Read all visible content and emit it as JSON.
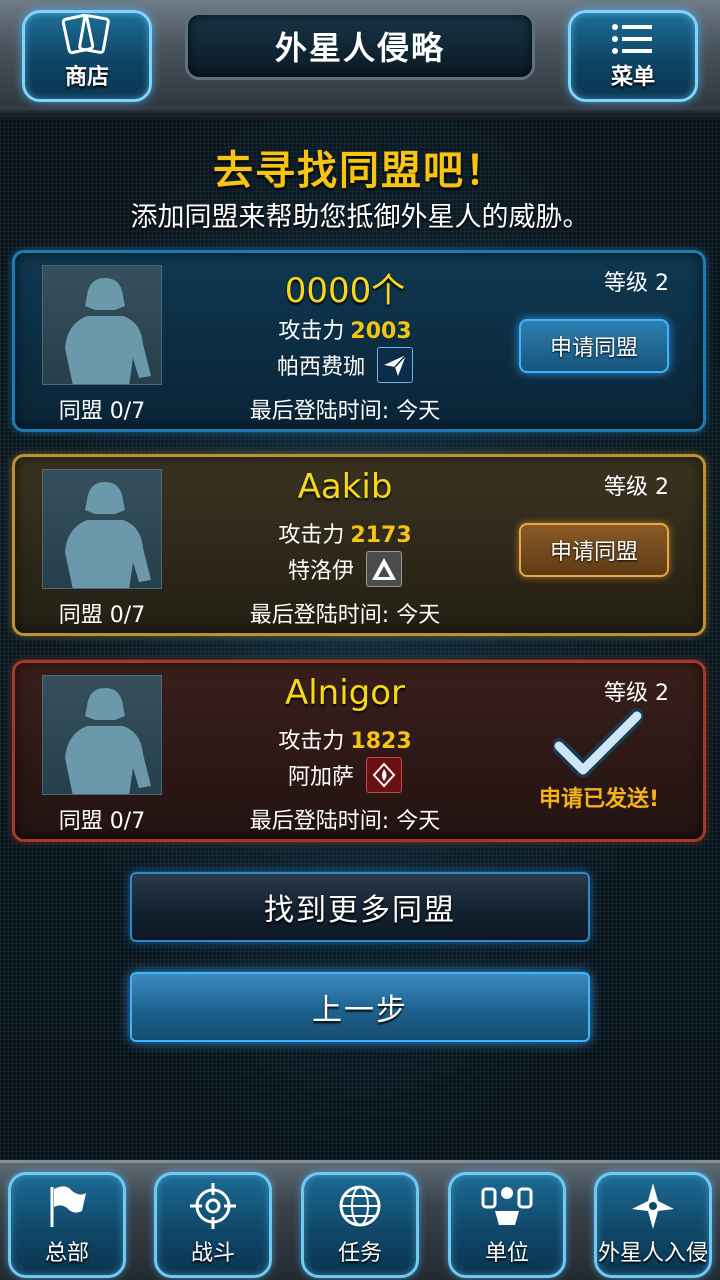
{
  "header": {
    "title": "外星人侵略",
    "shop_label": "商店",
    "menu_label": "菜单"
  },
  "heading": {
    "title": "去寻找同盟吧！",
    "subtitle": "添加同盟来帮助您抵御外星人的威胁。"
  },
  "labels": {
    "attack": "攻击力",
    "level_prefix": "等级",
    "alliance_prefix": "同盟",
    "last_login_prefix": "最后登陆时间:"
  },
  "players": [
    {
      "name": "0000个",
      "attack": "2003",
      "faction": "帕西费珈",
      "faction_icon": "paper-plane-icon",
      "level": "2",
      "alliance": "0/7",
      "last_login": "今天",
      "action": "申请同盟",
      "theme": "#1f7ab0"
    },
    {
      "name": "Aakib",
      "attack": "2173",
      "faction": "特洛伊",
      "faction_icon": "triangle-emblem-icon",
      "level": "2",
      "alliance": "0/7",
      "last_login": "今天",
      "action": "申请同盟",
      "theme": "#b89234"
    },
    {
      "name": "Alnigor",
      "attack": "1823",
      "faction": "阿加萨",
      "faction_icon": "flame-emblem-icon",
      "level": "2",
      "alliance": "0/7",
      "last_login": "今天",
      "action": "申请已发送!",
      "theme": "#a4392a"
    }
  ],
  "buttons": {
    "find_more": "找到更多同盟",
    "back": "上一步"
  },
  "nav": [
    {
      "label": "总部",
      "icon": "flag-icon"
    },
    {
      "label": "战斗",
      "icon": "crosshair-icon"
    },
    {
      "label": "任务",
      "icon": "globe-icon"
    },
    {
      "label": "单位",
      "icon": "units-icon"
    },
    {
      "label": "外星人入侵",
      "icon": "alien-ship-icon"
    }
  ],
  "colors": {
    "accent_yellow": "#f6c412",
    "accent_blue": "#3fb3ff",
    "sent_orange": "#f6b01a"
  }
}
